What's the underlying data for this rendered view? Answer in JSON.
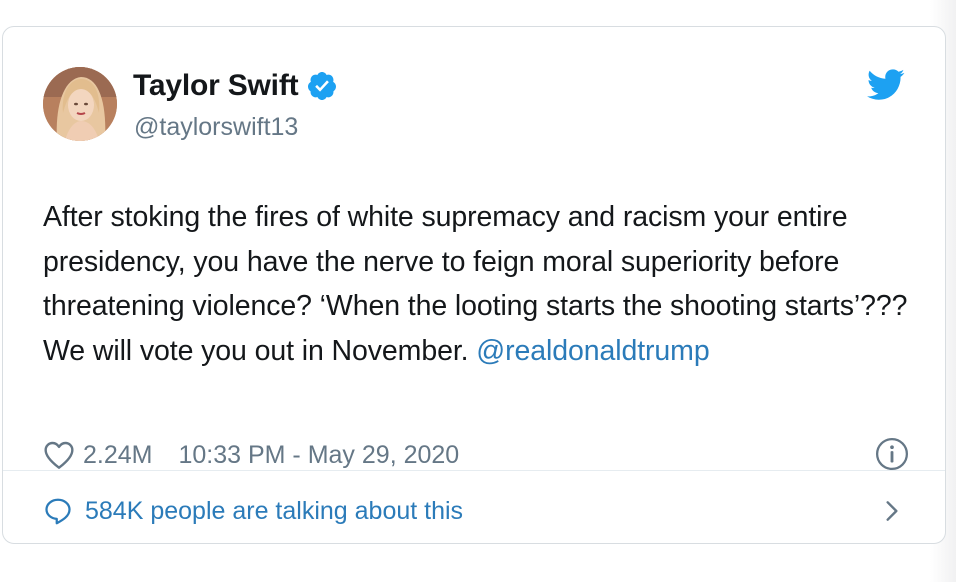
{
  "tweet": {
    "author": {
      "display_name": "Taylor Swift",
      "handle": "@taylorswift13",
      "verified": true,
      "avatar_icon": "profile-photo"
    },
    "text": {
      "body": "After stoking the fires of white supremacy and racism your entire presidency, you have the nerve to feign moral superiority before threatening violence? ‘When the looting starts the shooting starts’??? We will vote you out in November.",
      "mention": "@realdonaldtrump"
    },
    "likes": "2.24M",
    "timestamp": "10:33 PM - May 29, 2020",
    "conversation_text": "584K people are talking about this"
  },
  "icons": {
    "verified": "verified-badge-icon",
    "brand": "twitter-bird-icon",
    "like": "heart-icon",
    "info": "info-icon",
    "conversation": "speech-bubble-icon",
    "more": "chevron-right-icon"
  },
  "colors": {
    "brand_blue": "#1da1f2",
    "link_blue": "#2b7bb9",
    "text": "#14171a",
    "muted": "#657786",
    "border": "#d8dde1"
  }
}
